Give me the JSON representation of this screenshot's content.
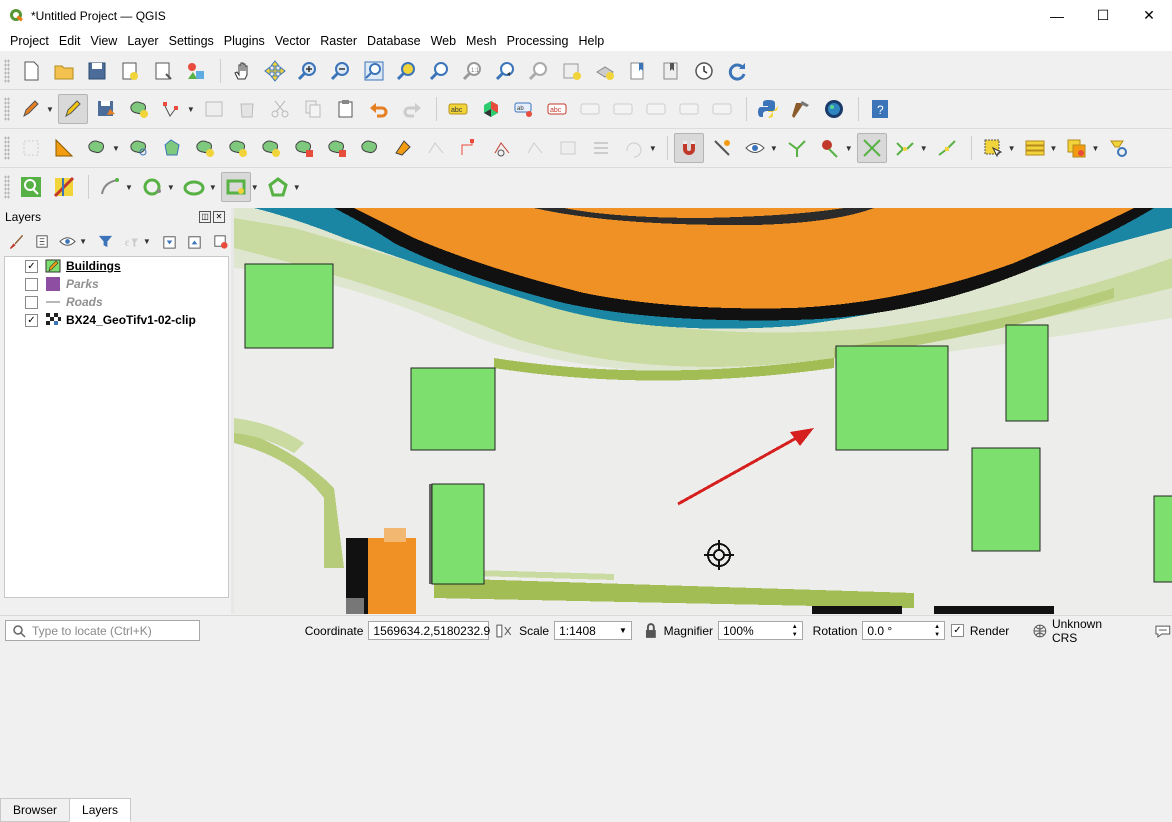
{
  "window": {
    "title": "*Untitled Project — QGIS",
    "controls": [
      "—",
      "☐",
      "✕"
    ]
  },
  "menu": [
    "Project",
    "Edit",
    "View",
    "Layer",
    "Settings",
    "Plugins",
    "Vector",
    "Raster",
    "Database",
    "Web",
    "Mesh",
    "Processing",
    "Help"
  ],
  "layers_panel": {
    "title": "Layers",
    "layers": [
      {
        "name": "Buildings",
        "checked": "✓",
        "style": "current",
        "icon": "pencil-polygon-icon"
      },
      {
        "name": "Parks",
        "checked": "",
        "style": "off",
        "icon": "polygon-fill-icon",
        "color": "#8e4ea1"
      },
      {
        "name": "Roads",
        "checked": "",
        "style": "off",
        "icon": "line-icon"
      },
      {
        "name": "BX24_GeoTifv1-02-clip",
        "checked": "✓",
        "style": "on",
        "icon": "raster-icon"
      }
    ],
    "tabs": [
      "Browser",
      "Layers"
    ]
  },
  "status": {
    "locate_placeholder": "Type to locate (Ctrl+K)",
    "coordinate_label": "Coordinate",
    "coordinate_value": "1569634.2,5180232.9",
    "scale_label": "Scale",
    "scale_value": "1:1408",
    "magnifier_label": "Magnifier",
    "magnifier_value": "100%",
    "rotation_label": "Rotation",
    "rotation_value": "0.0 °",
    "render_label": "Render",
    "render_checked": "✓",
    "crs_label": "Unknown CRS"
  },
  "colors": {
    "building_fill": "#7de06e",
    "road_orange": "#ef9124",
    "water_blue": "#1b86a4",
    "grass": "#a3bd55",
    "arrow": "#d62020"
  }
}
